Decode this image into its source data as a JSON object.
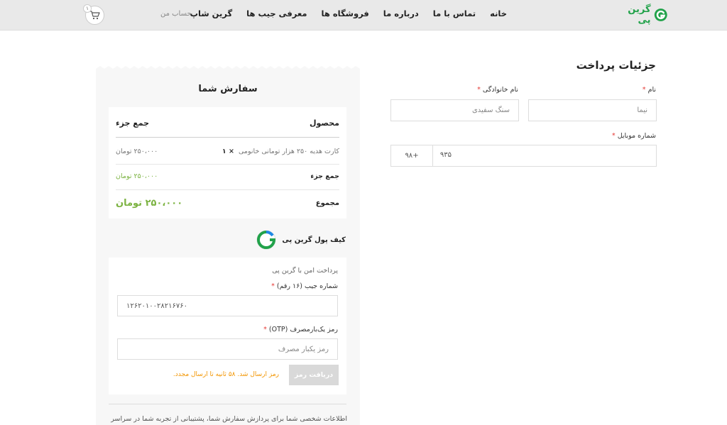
{
  "header": {
    "logo_text": "گرین پی",
    "nav": [
      "خانه",
      "تماس با ما",
      "درباره ما",
      "فروشگاه ها",
      "معرفی جیب ها",
      "گرین شاپ"
    ],
    "account": "حساب من",
    "cart_count": "۱"
  },
  "billing": {
    "title": "جزئیات پرداخت",
    "first_name_label": "نام",
    "first_name_value": "نیما",
    "last_name_label": "نام خانوادگی",
    "last_name_value": "سنگ سفیدی",
    "mobile_label": "شماره موبایل",
    "country_code": "+۹۸",
    "mobile_value": "۹۳۵"
  },
  "order": {
    "title": "سفارش شما",
    "col_product": "محصول",
    "col_subtotal": "جمع جزء",
    "item_name": "کارت هدیه ۲۵۰ هزار تومانی خانومی",
    "item_qty": "× ۱",
    "item_price": "۲۵۰،۰۰۰ تومان",
    "subtotal_label": "جمع جزء",
    "subtotal_value": "۲۵۰،۰۰۰ تومان",
    "total_label": "مجموع",
    "total_value": "۲۵۰،۰۰۰ تومان"
  },
  "payment": {
    "gateway_name": "کیف پول گرین پی",
    "secure_text": "پرداخت امن با گرین پی",
    "wallet_label": "شماره جیب (۱۶ رقم)",
    "wallet_value": "۱۲۶۲۰۱۰۰۲۸۲۱۶۷۶۰",
    "otp_label": "رمز یک‌بارمصرف (OTP)",
    "otp_placeholder": "رمز یکبار مصرف",
    "otp_button": "دریافت رمز",
    "otp_note": "رمز ارسال شد. ۵۸ ثانیه تا ارسال مجدد."
  },
  "privacy_text": "اطلاعات شخصی شما برای پردازش سفارش شما، پشتیبانی از تجربه شما در سراسر این",
  "colors": {
    "brand_green": "#21a24a",
    "price_green": "#7cb342",
    "warning_orange": "#f29500",
    "required_red": "#e53935"
  }
}
